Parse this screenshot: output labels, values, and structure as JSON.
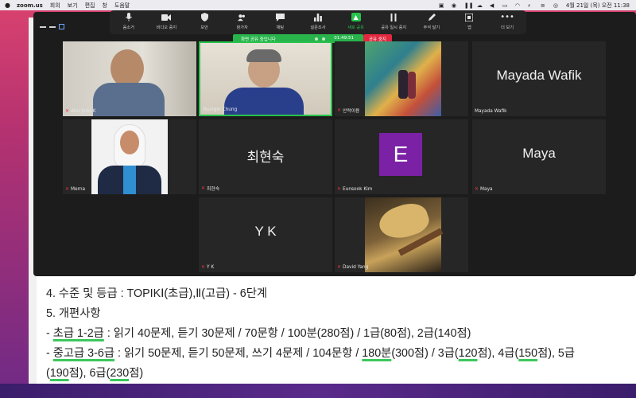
{
  "menubar": {
    "app": "zoom.us",
    "items": [
      "회의",
      "보기",
      "편집",
      "창",
      "도움말"
    ],
    "clock": "4월 21일 (목) 오전 11:38"
  },
  "toolbar": {
    "buttons": [
      {
        "label": "음소거",
        "icon": "microphone-icon"
      },
      {
        "label": "비디오 중지",
        "icon": "video-camera-icon"
      },
      {
        "label": "보안",
        "icon": "shield-icon"
      },
      {
        "label": "참가자",
        "icon": "participants-icon",
        "count": "10"
      },
      {
        "label": "채팅",
        "icon": "chat-icon"
      },
      {
        "label": "설문조사",
        "icon": "poll-icon"
      },
      {
        "label": "새로 공유",
        "icon": "share-screen-icon"
      },
      {
        "label": "공유 일시 중지",
        "icon": "pause-icon"
      },
      {
        "label": "주석 달기",
        "icon": "annotate-pen-icon"
      },
      {
        "label": "앱",
        "icon": "apps-icon"
      },
      {
        "label": "더 보기",
        "icon": "more-icon"
      }
    ]
  },
  "share_banner": {
    "text": "화면 공유 중입니다",
    "timer": "01:49:51",
    "stop_label": "공유 중지"
  },
  "tiles": [
    {
      "name": "Abu John K",
      "big": ""
    },
    {
      "name": "Youngin Chung",
      "big": ""
    },
    {
      "name": "안락이용",
      "big": ""
    },
    {
      "name": "Mayada Wafik",
      "big": "Mayada Wafik"
    },
    {
      "name": "Merna",
      "big": ""
    },
    {
      "name": "최현숙",
      "big": "최현숙"
    },
    {
      "name": "Eunsook Kim",
      "big": "E"
    },
    {
      "name": "Maya",
      "big": "Maya"
    },
    {
      "name": "Y K",
      "big": "Y K"
    },
    {
      "name": "David Yang",
      "big": ""
    }
  ],
  "document": {
    "line1": "4. 수준 및 등급 : TOPIKⅠ(초급),Ⅱ(고급) - 6단계",
    "line2": "5. 개편사항",
    "line3_prefix": "- ",
    "line3_ul": "초급 1-2급",
    "line3_rest": " : 읽기 40문제, 듣기 30문제 / 70문항 / 100분(280점) / 1급(80점), 2급(140점)",
    "line4_prefix": "- ",
    "line4_ul": "중고급 3-6급",
    "line4_mid": " : 읽기 50문제, 듣기 50문제, 쓰기 4문제 / 104문항 / ",
    "line4_ul2": "180분",
    "line4_mid2": "(300점) / 3급(",
    "line4_ul3": "120",
    "line4_mid3": "점), 4급(",
    "line4_ul4": "150",
    "line4_mid4": "점), 5급",
    "line5_pre": "(",
    "line5_ul1": "190",
    "line5_mid": "점), 6급(",
    "line5_ul2": "230",
    "line5_end": "점)"
  }
}
